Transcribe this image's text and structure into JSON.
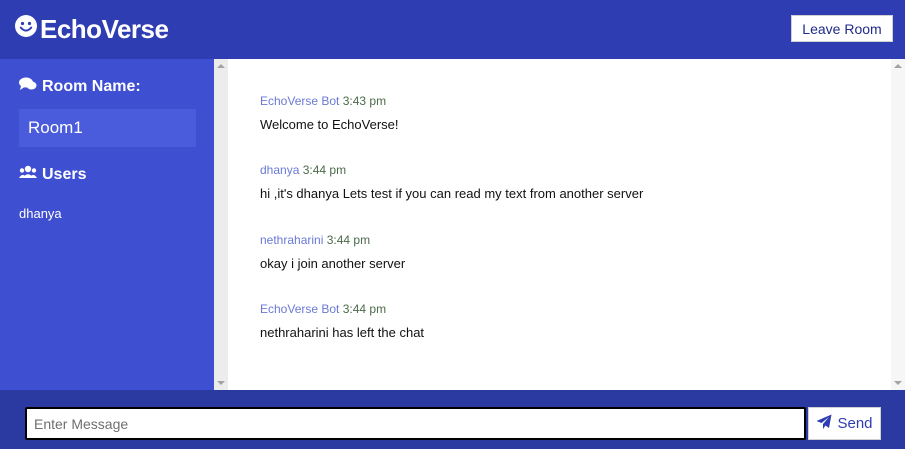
{
  "header": {
    "app_name": "EchoVerse",
    "logo_icon": "smiley-icon",
    "leave_label": "Leave Room"
  },
  "sidebar": {
    "room_heading": "Room Name:",
    "room_icon": "comments-icon",
    "room_name": "Room1",
    "users_heading": "Users",
    "users_icon": "users-icon",
    "users": [
      "dhanya"
    ]
  },
  "messages": [
    {
      "sender": "EchoVerse Bot",
      "time": "3:43 pm",
      "text": "Welcome to EchoVerse!"
    },
    {
      "sender": "dhanya",
      "time": "3:44 pm",
      "text": "hi ,it's dhanya Lets test if you can read my text from another server"
    },
    {
      "sender": "nethraharini",
      "time": "3:44 pm",
      "text": "okay i join another server"
    },
    {
      "sender": "EchoVerse Bot",
      "time": "3:44 pm",
      "text": "nethraharini has left the chat"
    }
  ],
  "footer": {
    "input_placeholder": "Enter Message",
    "input_value": "",
    "send_label": "Send",
    "send_icon": "paper-plane-icon"
  },
  "colors": {
    "header_bg": "#2f3db2",
    "sidebar_bg": "#3f4fd1",
    "footer_bg": "#2b3aa0",
    "sender_color": "#6a79d6",
    "time_color": "#4a6a4a"
  }
}
